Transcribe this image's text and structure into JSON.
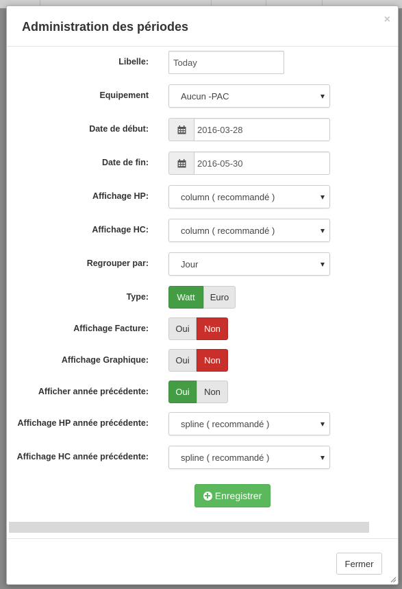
{
  "modal": {
    "title": "Administration des périodes",
    "close_icon": "×"
  },
  "form": {
    "libelle": {
      "label": "Libelle:",
      "value": "Today"
    },
    "equipement": {
      "label": "Equipement",
      "value": "Aucun -PAC"
    },
    "date_debut": {
      "label": "Date de début:",
      "value": "2016-03-28",
      "icon": "calendar-icon"
    },
    "date_fin": {
      "label": "Date de fin:",
      "value": "2016-05-30",
      "icon": "calendar-icon"
    },
    "affichage_hp": {
      "label": "Affichage HP:",
      "value": "column ( recommandé )"
    },
    "affichage_hc": {
      "label": "Affichage HC:",
      "value": "column ( recommandé )"
    },
    "regrouper_par": {
      "label": "Regrouper par:",
      "value": "Jour"
    },
    "type": {
      "label": "Type:",
      "option_a": "Watt",
      "option_b": "Euro",
      "selected": "Watt"
    },
    "affichage_facture": {
      "label": "Affichage Facture:",
      "option_a": "Oui",
      "option_b": "Non",
      "selected": "Non"
    },
    "affichage_graphique": {
      "label": "Affichage Graphique:",
      "option_a": "Oui",
      "option_b": "Non",
      "selected": "Non"
    },
    "afficher_annee_precedente": {
      "label": "Afficher année précédente:",
      "option_a": "Oui",
      "option_b": "Non",
      "selected": "Oui"
    },
    "affichage_hp_annee_precedente": {
      "label": "Affichage HP année précédente:",
      "value": "spline ( recommandé )"
    },
    "affichage_hc_annee_precedente": {
      "label": "Affichage HC année précédente:",
      "value": "spline ( recommandé )"
    }
  },
  "actions": {
    "save_label": "Enregistrer",
    "close_label": "Fermer"
  },
  "colors": {
    "success": "#449d44",
    "danger": "#c9302c",
    "save": "#5cb85c"
  }
}
